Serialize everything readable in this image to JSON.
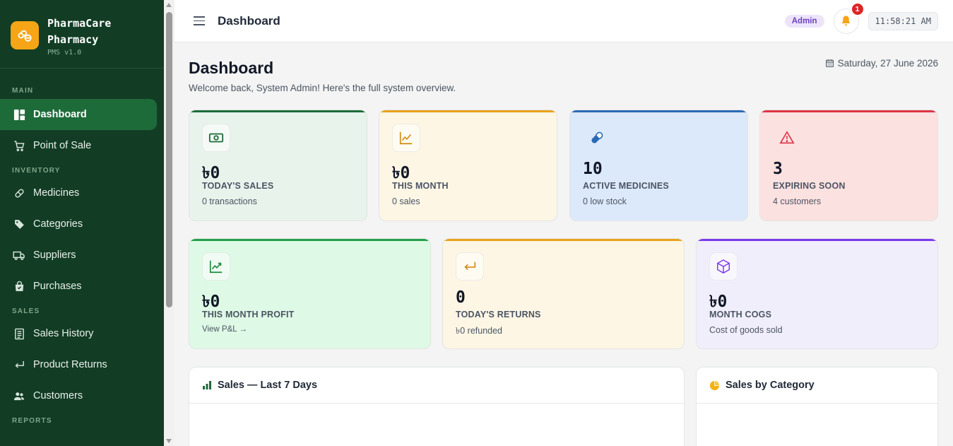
{
  "brand": {
    "name_line1": "PharmaCare",
    "name_line2": "Pharmacy",
    "version": "PMS v1.0"
  },
  "sidebar": {
    "sections": [
      {
        "label": "MAIN"
      },
      {
        "label": "INVENTORY"
      },
      {
        "label": "SALES"
      },
      {
        "label": "REPORTS"
      }
    ],
    "items": [
      {
        "label": "Dashboard",
        "icon": "dashboard-icon",
        "active": true
      },
      {
        "label": "Point of Sale",
        "icon": "cart-icon"
      },
      {
        "label": "Medicines",
        "icon": "pill-icon"
      },
      {
        "label": "Categories",
        "icon": "tag-icon"
      },
      {
        "label": "Suppliers",
        "icon": "truck-icon"
      },
      {
        "label": "Purchases",
        "icon": "bag-icon"
      },
      {
        "label": "Sales History",
        "icon": "receipt-icon"
      },
      {
        "label": "Product Returns",
        "icon": "return-icon"
      },
      {
        "label": "Customers",
        "icon": "users-icon"
      }
    ]
  },
  "topbar": {
    "title": "Dashboard",
    "role": "Admin",
    "notification_count": "1",
    "clock": "11:58:21 AM"
  },
  "page": {
    "title": "Dashboard",
    "subtitle": "Welcome back, System Admin! Here's the full system overview.",
    "date": "Saturday, 27 June 2026"
  },
  "stats_row1": [
    {
      "value": "৳0",
      "label": "TODAY'S SALES",
      "note": "0 transactions",
      "accent": "#1e6b3a",
      "bg": "#e8f3ec",
      "icon": "cash-icon"
    },
    {
      "value": "৳0",
      "label": "THIS MONTH",
      "note": "0 sales",
      "accent": "#eaa21a",
      "bg": "#fdf6e5",
      "icon": "chart-line-icon"
    },
    {
      "value": "10",
      "label": "ACTIVE MEDICINES",
      "note": "0 low stock",
      "accent": "#2a6bb3",
      "bg": "#dce9fb",
      "icon": "pill-icon"
    },
    {
      "value": "3",
      "label": "EXPIRING SOON",
      "note": "4 customers",
      "accent": "#dc3545",
      "bg": "#fce1e1",
      "icon": "warning-icon"
    }
  ],
  "stats_row2": [
    {
      "value": "৳0",
      "label": "THIS MONTH PROFIT",
      "note": "View P&L →",
      "accent": "#22a04b",
      "bg": "#def9e5",
      "icon": "trend-up-icon"
    },
    {
      "value": "0",
      "label": "TODAY'S RETURNS",
      "note": "৳0 refunded",
      "accent": "#eaa21a",
      "bg": "#fdf6e5",
      "icon": "return-icon"
    },
    {
      "value": "৳0",
      "label": "MONTH COGS",
      "note": "Cost of goods sold",
      "accent": "#7c3aed",
      "bg": "#f1eefc",
      "icon": "box-icon"
    }
  ],
  "panels": {
    "sales_chart_title": "Sales — Last 7 Days",
    "category_chart_title": "Sales by Category"
  },
  "colors": {
    "sidebar_bg": "#123d24",
    "active_item": "#1e6b3a",
    "brand_logo": "#f5a516"
  }
}
